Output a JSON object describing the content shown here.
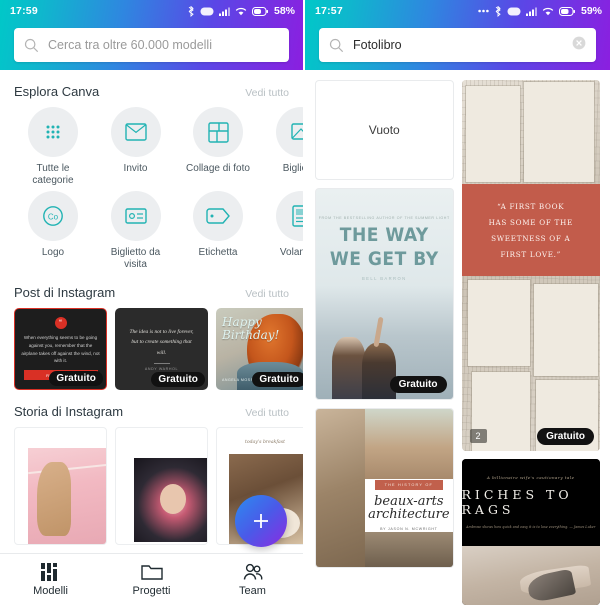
{
  "left": {
    "status": {
      "time": "17:59",
      "battery": "58%"
    },
    "search": {
      "placeholder": "Cerca tra oltre 60.000 modelli",
      "value": ""
    },
    "sections": [
      {
        "title": "Esplora Canva",
        "more": "Vedi tutto"
      },
      {
        "title": "Post di Instagram",
        "more": "Vedi tutto"
      },
      {
        "title": "Storia di Instagram",
        "more": "Vedi tutto"
      }
    ],
    "categories": [
      {
        "label": "Tutte le categorie",
        "icon": "grid-dots-icon"
      },
      {
        "label": "Invito",
        "icon": "invitation-icon"
      },
      {
        "label": "Collage di foto",
        "icon": "collage-icon"
      },
      {
        "label": "Biglietto",
        "icon": "card-icon"
      },
      {
        "label": "Logo",
        "icon": "logo-circle-icon"
      },
      {
        "label": "Biglietto da visita",
        "icon": "business-card-icon"
      },
      {
        "label": "Etichetta",
        "icon": "tag-icon"
      },
      {
        "label": "Volantino",
        "icon": "flyer-icon"
      }
    ],
    "posts": [
      {
        "name": "airplane-quote-post",
        "badge": "Gratuito",
        "text": "When everything seems to be going against you, remember that the airplane takes off against the wind, not with it.",
        "button": "READ MORE",
        "mark": "“"
      },
      {
        "name": "create-quote-post",
        "badge": "Gratuito",
        "text": "The idea is not to live forever, but to create something that will.",
        "author": "ANDY WARHOL"
      },
      {
        "name": "happy-birthday-post",
        "badge": "Gratuito",
        "title_line1": "Happy",
        "title_line2": "Birthday!",
        "subtitle": "ANGELA MOSS  WISHES YOU"
      }
    ],
    "stories": [
      {
        "name": "pink-fashion-story"
      },
      {
        "name": "floral-portrait-story"
      },
      {
        "name": "breakfast-story",
        "caption": "today's breakfast"
      }
    ],
    "fab": {
      "icon": "plus-icon",
      "label": "+"
    },
    "nav": [
      {
        "label": "Modelli",
        "icon": "templates-icon",
        "active": true
      },
      {
        "label": "Progetti",
        "icon": "folder-icon",
        "active": false
      },
      {
        "label": "Team",
        "icon": "team-icon",
        "active": false
      }
    ]
  },
  "right": {
    "status": {
      "time": "17:57",
      "battery": "59%"
    },
    "search": {
      "placeholder": "Cerca tra oltre 60.000 modelli",
      "value": "Fotolibro",
      "clear": "clear-icon"
    },
    "results": [
      {
        "name": "blank-template-card",
        "label": "Vuoto"
      },
      {
        "name": "the-way-we-get-by-card",
        "kicker": "FROM THE BESTSELLING AUTHOR OF THE SUMMER LIGHT",
        "title_line1": "THE WAY",
        "title_line2": "WE GET BY",
        "author": "BELL BARRON",
        "badge": "Gratuito"
      },
      {
        "name": "beaux-arts-card",
        "kicker": "THE HISTORY OF",
        "title_line1": "beaux-arts",
        "title_line2": "architecture",
        "author": "BY JASON N. MCWRIGHT"
      },
      {
        "name": "first-book-quote-card",
        "quote_lines": [
          "“A FIRST BOOK",
          "HAS SOME OF THE",
          "SWEETNESS OF A",
          "FIRST LOVE.”"
        ],
        "pages": "2",
        "badge": "Gratuito"
      },
      {
        "name": "riches-to-rags-card",
        "kicker": "A billionaire wife's cautionary tale",
        "title": "RICHES TO RAGS",
        "subtitle": "Ambrose shows how quick and easy it is to lose everything. — James Luker"
      }
    ]
  },
  "colors": {
    "gradient_start": "#00c8c8",
    "gradient_end": "#8b1fe0",
    "accent_teal": "#21b3b3",
    "fab_start": "#2b8cf0",
    "fab_end": "#8b2be2",
    "quote_red": "#c25c4b"
  }
}
